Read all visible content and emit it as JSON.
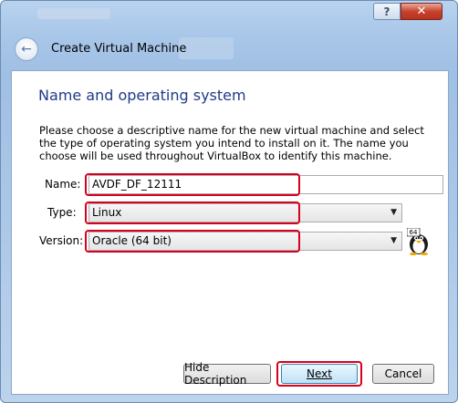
{
  "window": {
    "help_glyph": "?",
    "close_glyph": "✕",
    "back_glyph": "←",
    "wizard_title": "Create Virtual Machine"
  },
  "page": {
    "section_title": "Name and operating system",
    "description": "Please choose a descriptive name for the new virtual machine and select the type of operating system you intend to install on it. The name you choose will be used throughout VirtualBox to identify this machine."
  },
  "form": {
    "name_label": "Name:",
    "name_value": "AVDF_DF_12111",
    "type_label": "Type:",
    "type_value": "Linux",
    "version_label": "Version:",
    "version_value": "Oracle (64 bit)",
    "os_badge": "64"
  },
  "buttons": {
    "hide_description": "Hide Description",
    "next": "Next",
    "cancel": "Cancel"
  },
  "colors": {
    "highlight": "#d9001b",
    "section_title": "#1e3a8a"
  },
  "icons": {
    "os": "tux-penguin-icon"
  }
}
